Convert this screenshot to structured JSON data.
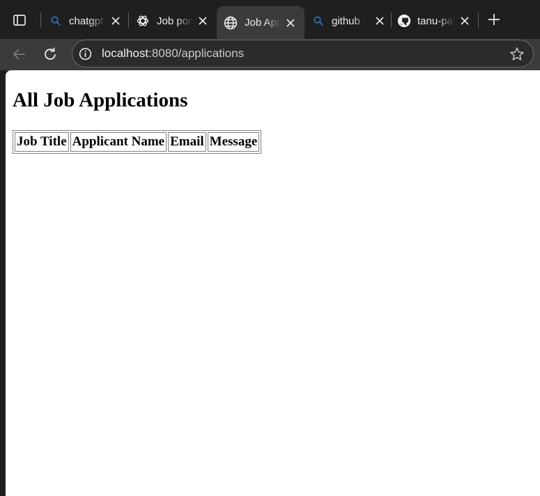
{
  "browser": {
    "tabs": [
      {
        "title": "chatgpt",
        "icon": "search-icon",
        "active": false
      },
      {
        "title": "Job portal",
        "icon": "chatgpt-icon",
        "active": false
      },
      {
        "title": "Job Applications",
        "icon": "globe-icon",
        "active": true
      },
      {
        "title": "github",
        "icon": "search-icon",
        "active": false
      },
      {
        "title": "tanu-pal",
        "icon": "github-icon",
        "active": false
      }
    ],
    "address": {
      "host": "localhost",
      "rest": ":8080/applications"
    },
    "colors": {
      "chrome_bg": "#1f1f1f",
      "toolbar_bg": "#3b3b3b",
      "text": "#ededed"
    }
  },
  "page": {
    "heading": "All Job Applications",
    "table": {
      "columns": [
        "Job Title",
        "Applicant Name",
        "Email",
        "Message"
      ],
      "rows": []
    }
  }
}
